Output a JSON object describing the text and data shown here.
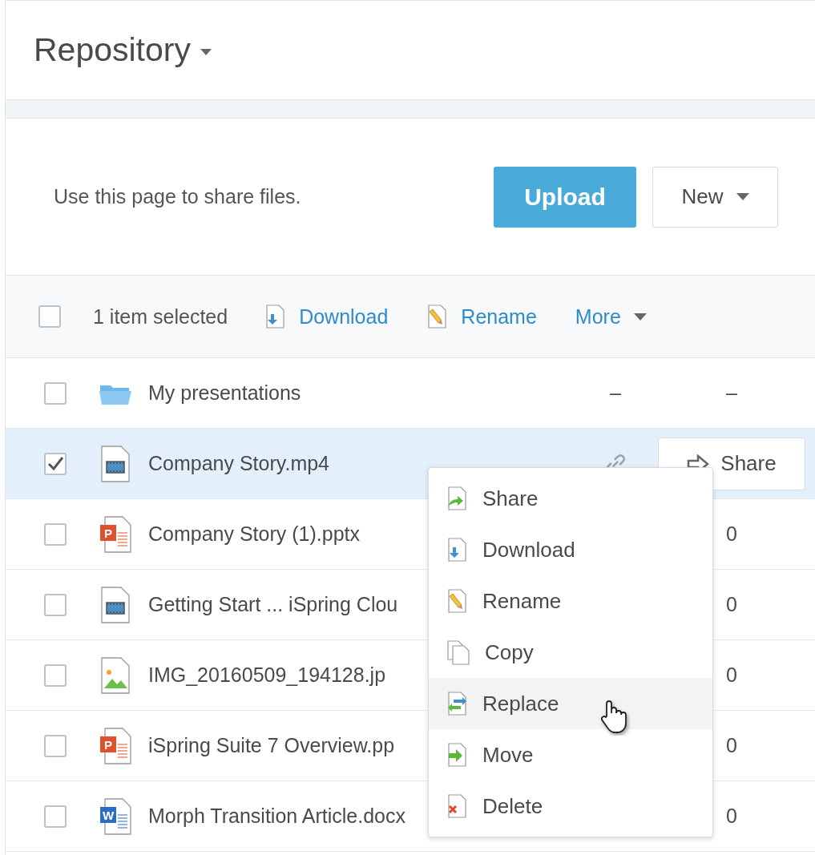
{
  "header": {
    "title": "Repository"
  },
  "intro": {
    "text": "Use this page to share files.",
    "primary_button": "Upload",
    "secondary_button": "New"
  },
  "toolbar": {
    "checked": false,
    "selection_text": "1 item selected",
    "actions": [
      {
        "kind": "download",
        "label": "Download"
      },
      {
        "kind": "rename",
        "label": "Rename"
      },
      {
        "kind": "more",
        "label": "More"
      }
    ]
  },
  "rows": [
    {
      "kind": "folder",
      "name": "My presentations",
      "checked": false,
      "selected": false,
      "column_1": "–",
      "column_2": "–"
    },
    {
      "kind": "video",
      "name": "Company Story.mp4",
      "checked": true,
      "selected": true,
      "shared": true,
      "share_button": "Share"
    },
    {
      "kind": "presentation",
      "icon_label": "P",
      "name": "Company Story (1).pptx",
      "checked": false,
      "selected": false,
      "column_2": "0"
    },
    {
      "kind": "video",
      "name": "Getting Start ... iSpring Clou",
      "checked": false,
      "selected": false,
      "column_2": "0"
    },
    {
      "kind": "image",
      "name": "IMG_20160509_194128.jp",
      "checked": false,
      "selected": false,
      "column_2": "0"
    },
    {
      "kind": "presentation",
      "icon_label": "P",
      "name": "iSpring Suite 7 Overview.pp",
      "checked": false,
      "selected": false,
      "column_2": "0"
    },
    {
      "kind": "document",
      "icon_label": "W",
      "name": "Morph Transition Article.docx",
      "checked": false,
      "selected": false,
      "column_2": "0"
    }
  ],
  "context_menu": {
    "items": [
      {
        "kind": "share",
        "label": "Share",
        "hovered": false
      },
      {
        "kind": "download",
        "label": "Download",
        "hovered": false
      },
      {
        "kind": "rename",
        "label": "Rename",
        "hovered": false
      },
      {
        "kind": "copy",
        "label": "Copy",
        "hovered": false
      },
      {
        "kind": "replace",
        "label": "Replace",
        "hovered": true
      },
      {
        "kind": "move",
        "label": "Move",
        "hovered": false
      },
      {
        "kind": "delete",
        "label": "Delete",
        "hovered": false
      }
    ]
  }
}
